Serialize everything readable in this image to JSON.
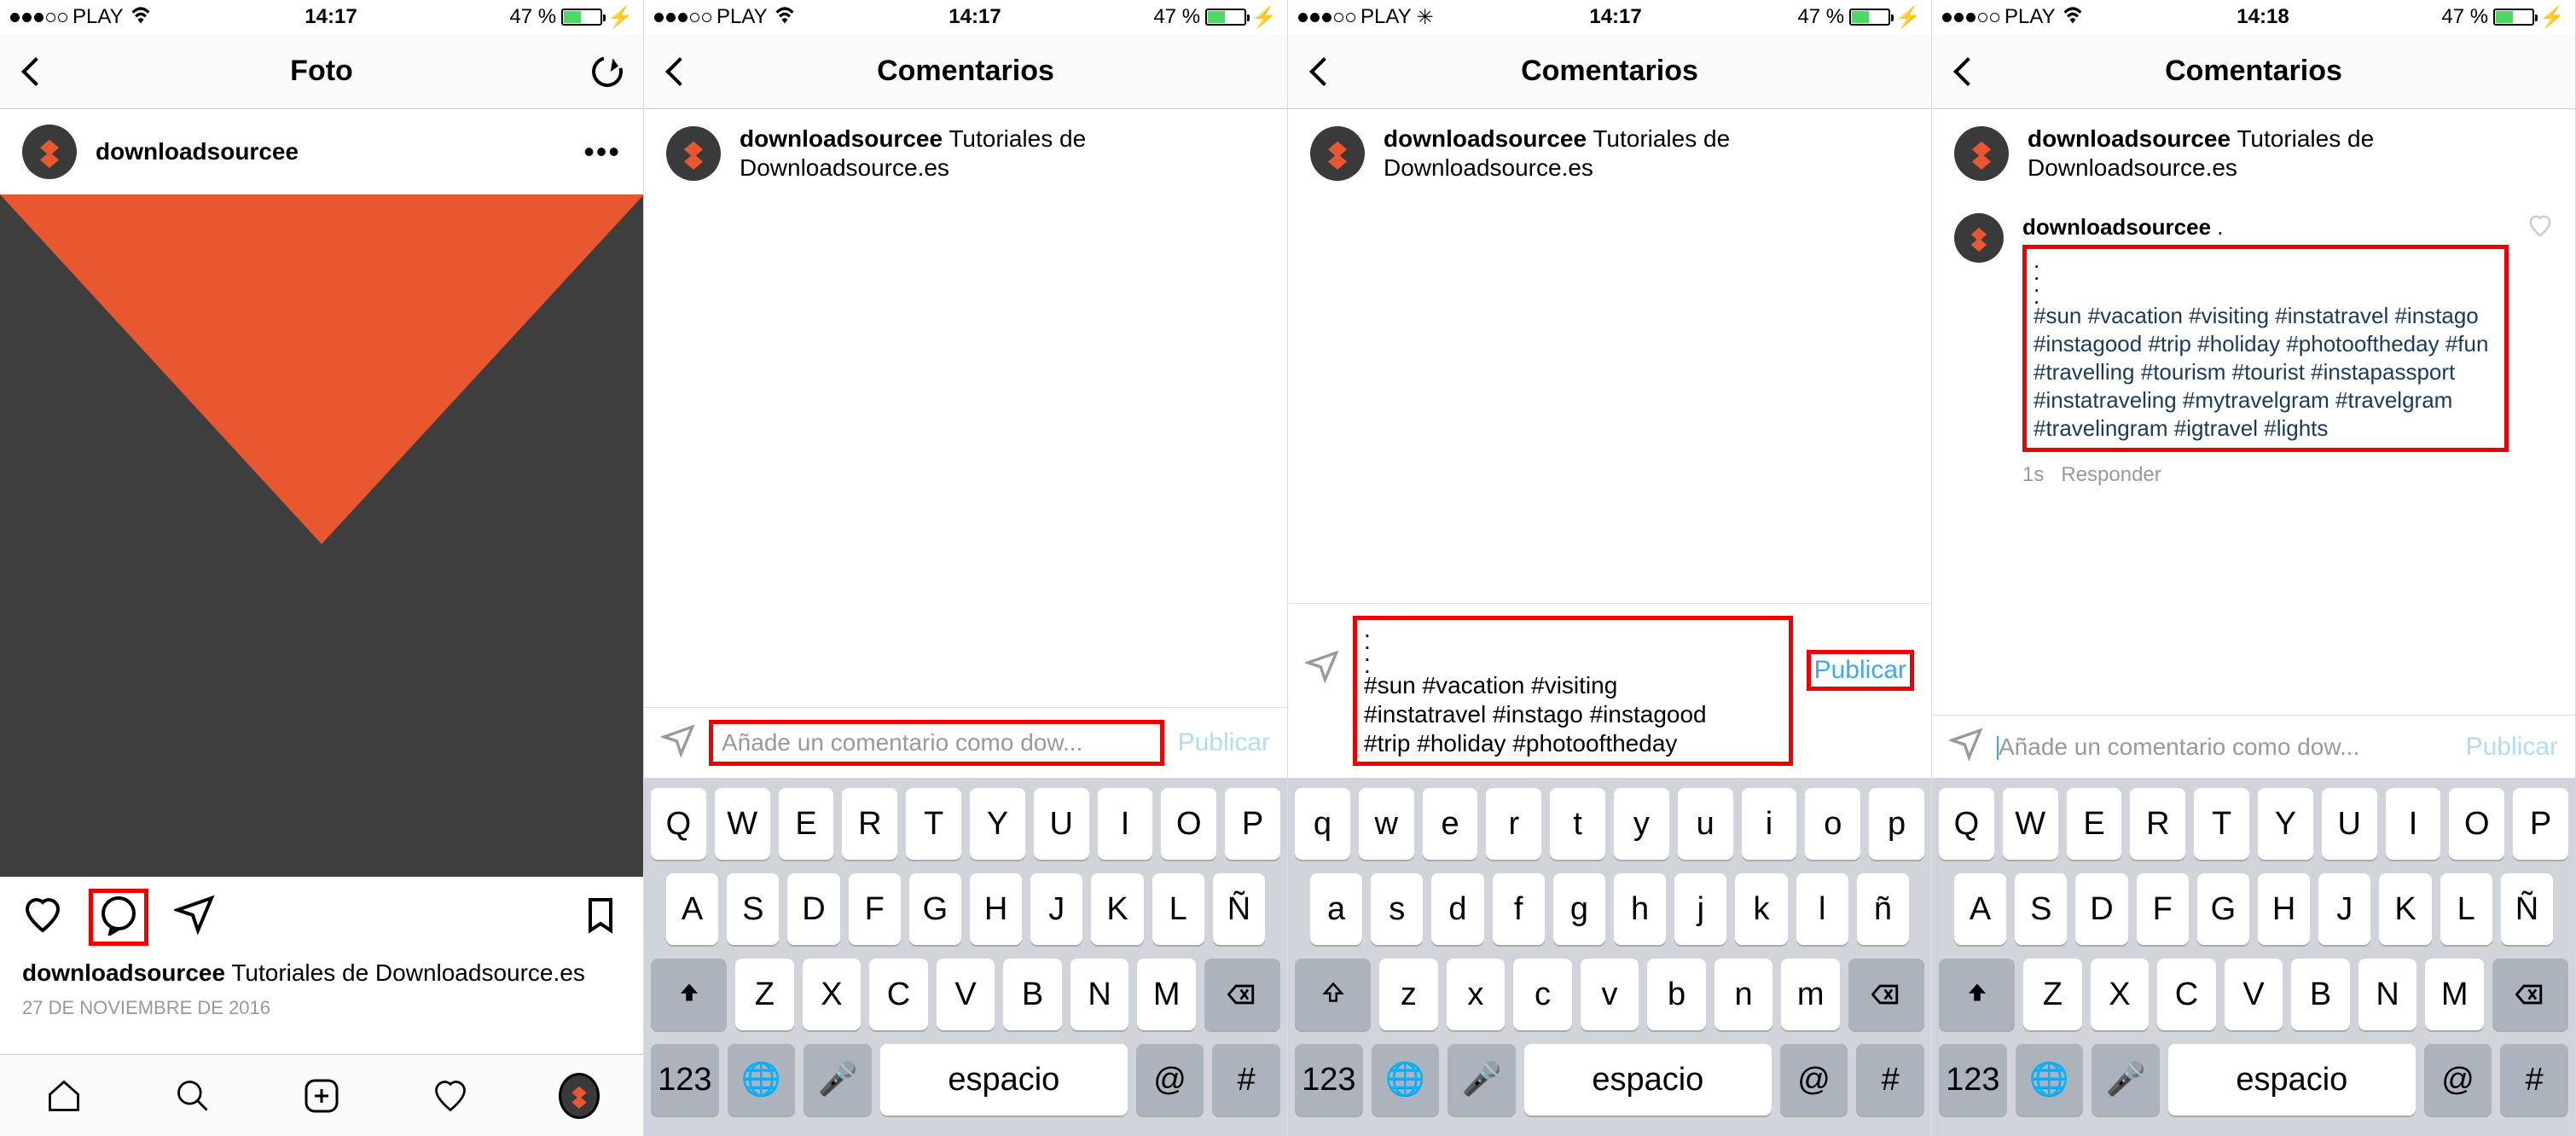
{
  "status": {
    "carrier": "PLAY",
    "time1": "14:17",
    "time4": "14:18",
    "battery_pct": "47 %"
  },
  "screen1": {
    "title": "Foto",
    "username": "downloadsourcee",
    "caption_user": "downloadsourcee",
    "caption_text": "Tutoriales de Downloadsource.es",
    "date": "27 DE NOVIEMBRE DE 2016"
  },
  "screen2": {
    "title": "Comentarios",
    "header_user": "downloadsourcee",
    "header_text": "Tutoriales de Downloadsource.es",
    "input_placeholder": "Añade un comentario como dow...",
    "publish": "Publicar"
  },
  "screen3": {
    "title": "Comentarios",
    "header_user": "downloadsourcee",
    "header_text": "Tutoriales de Downloadsource.es",
    "draft_dots": ". . . .",
    "draft_line1": "#sun #vacation #visiting",
    "draft_line2": "#instatravel #instago #instagood",
    "draft_line3": "#trip #holiday #photooftheday",
    "publish": "Publicar"
  },
  "screen4": {
    "title": "Comentarios",
    "header_user": "downloadsourcee",
    "header_text": "Tutoriales de Downloadsource.es",
    "comment_user": "downloadsourcee",
    "comment_lead": ".",
    "hashtags": "#sun #vacation #visiting #instatravel #instago #instagood #trip #holiday #photooftheday #fun #travelling #tourism #tourist #instapassport #instatraveling #mytravelgram #travelgram #travelingram #igtravel #lights",
    "comment_time": "1s",
    "reply": "Responder",
    "input_placeholder": "Añade un comentario como dow...",
    "publish": "Publicar"
  },
  "keyboard": {
    "upper": {
      "r1": [
        "Q",
        "W",
        "E",
        "R",
        "T",
        "Y",
        "U",
        "I",
        "O",
        "P"
      ],
      "r2": [
        "A",
        "S",
        "D",
        "F",
        "G",
        "H",
        "J",
        "K",
        "L",
        "Ñ"
      ],
      "r3": [
        "Z",
        "X",
        "C",
        "V",
        "B",
        "N",
        "M"
      ]
    },
    "lower": {
      "r1": [
        "q",
        "w",
        "e",
        "r",
        "t",
        "y",
        "u",
        "i",
        "o",
        "p"
      ],
      "r2": [
        "a",
        "s",
        "d",
        "f",
        "g",
        "h",
        "j",
        "k",
        "l",
        "ñ"
      ],
      "r3": [
        "z",
        "x",
        "c",
        "v",
        "b",
        "n",
        "m"
      ]
    },
    "space": "espacio",
    "num": "123",
    "at": "@",
    "hash": "#"
  }
}
